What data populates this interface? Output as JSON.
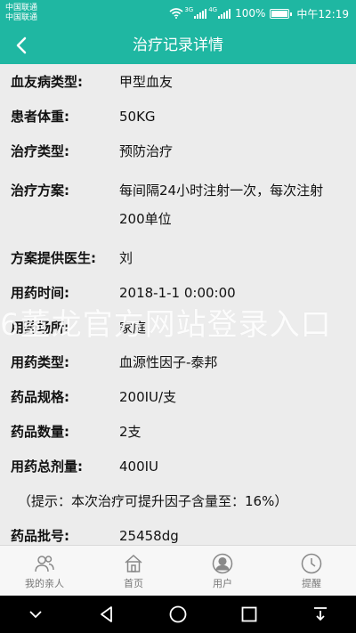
{
  "status_bar": {
    "carrier_1": "中国联通",
    "carrier_2": "中国联通",
    "signal_1": "3G",
    "signal_2": "4G",
    "battery": "100%",
    "time": "中午12:19"
  },
  "header": {
    "title": "治疗记录详情",
    "back_icon": "chevron-left-icon",
    "color": "#1fb7a2"
  },
  "fields": [
    {
      "label": "血友病类型:",
      "value": "甲型血友"
    },
    {
      "label": "患者体重:",
      "value": "50KG"
    },
    {
      "label": "治疗类型:",
      "value": "预防治疗"
    },
    {
      "label": "治疗方案:",
      "value": "每间隔24小时注射一次，每次注射200单位"
    },
    {
      "label": "方案提供医生:",
      "value": "刘"
    },
    {
      "label": "用药时间:",
      "value": "2018-1-1 0:00:00"
    },
    {
      "label": "用药场所:",
      "value": "家庭"
    },
    {
      "label": "用药类型:",
      "value": "血源性因子-泰邦"
    },
    {
      "label": "药品规格:",
      "value": "200IU/支"
    },
    {
      "label": "药品数量:",
      "value": "2支"
    },
    {
      "label": "用药总剂量:",
      "value": "400IU"
    }
  ],
  "tip": "（提示：本次治疗可提升因子含量至：16%）",
  "batch": {
    "label": "药品批号:",
    "value": "25458dg"
  },
  "watermark": "6董龙官方网站登录入口",
  "tabbar": [
    {
      "label": "我的亲人",
      "icon": "family-icon"
    },
    {
      "label": "首页",
      "icon": "home-icon"
    },
    {
      "label": "用户",
      "icon": "user-icon"
    },
    {
      "label": "提醒",
      "icon": "clock-icon"
    }
  ],
  "navbar": [
    "chevron-down-icon",
    "back-triangle-icon",
    "home-circle-icon",
    "recent-square-icon",
    "notification-pull-icon"
  ]
}
